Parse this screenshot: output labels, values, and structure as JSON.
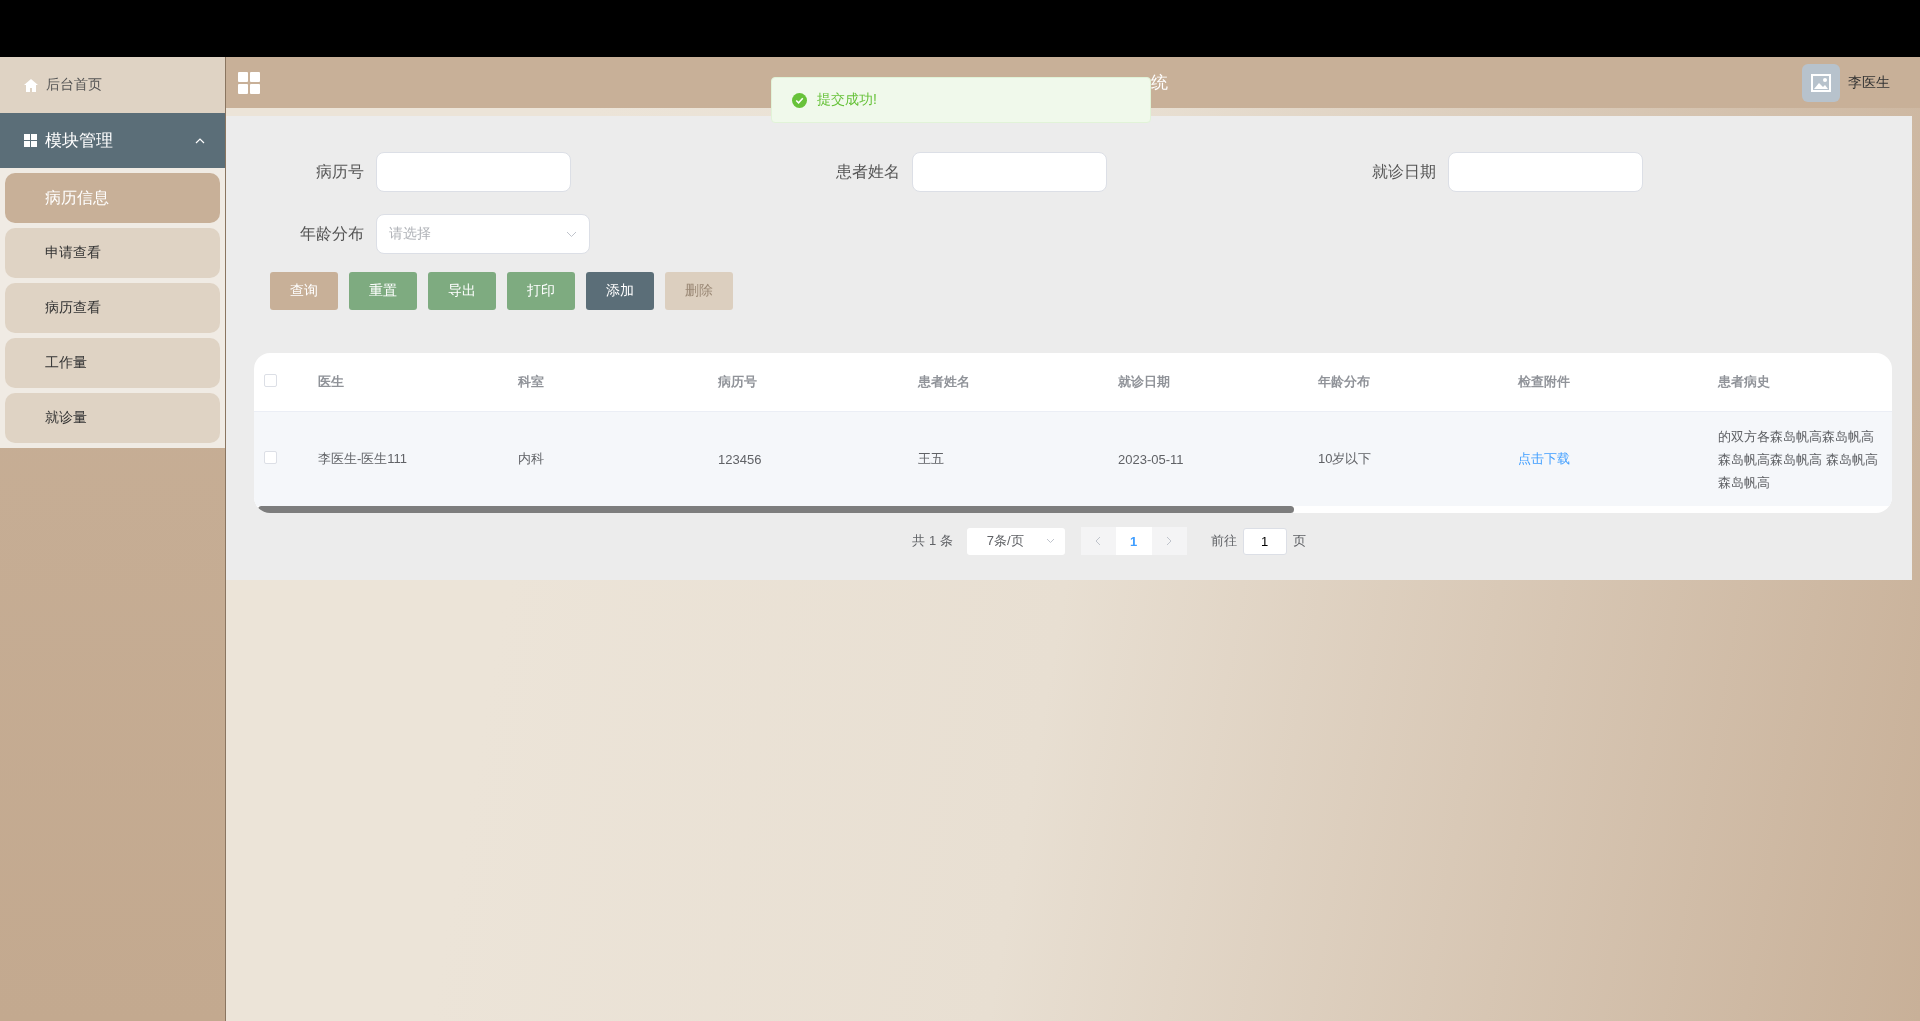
{
  "sidebar": {
    "home": {
      "label": "后台首页"
    },
    "group": {
      "label": "模块管理",
      "expanded": true
    },
    "items": [
      {
        "label": "病历信息",
        "selected": true
      },
      {
        "label": "申请查看",
        "selected": false
      },
      {
        "label": "病历查看",
        "selected": false
      },
      {
        "label": "工作量",
        "selected": false
      },
      {
        "label": "就诊量",
        "selected": false
      }
    ]
  },
  "header": {
    "title": "统",
    "user": "李医生"
  },
  "toast": {
    "message": "提交成功!"
  },
  "filters": [
    {
      "label": "病历号",
      "kind": "input"
    },
    {
      "label": "患者姓名",
      "kind": "input"
    },
    {
      "label": "就诊日期",
      "kind": "input"
    },
    {
      "label": "年龄分布",
      "kind": "select",
      "placeholder": "请选择"
    }
  ],
  "buttons": [
    {
      "label": "查询",
      "color": "#c8b098",
      "disabled": false
    },
    {
      "label": "重置",
      "color": "#7eab80",
      "disabled": false
    },
    {
      "label": "导出",
      "color": "#7eab80",
      "disabled": false
    },
    {
      "label": "打印",
      "color": "#7eab80",
      "disabled": false
    },
    {
      "label": "添加",
      "color": "#5b6e78",
      "disabled": false
    },
    {
      "label": "删除",
      "color": "#dccfbf",
      "disabled": true
    }
  ],
  "table": {
    "select_all": {
      "checked": false
    },
    "columns": [
      "医生",
      "科室",
      "病历号",
      "患者姓名",
      "就诊日期",
      "年龄分布",
      "检查附件",
      "患者病史"
    ],
    "rows": [
      {
        "checked": false,
        "cells": [
          "李医生-医生111",
          "内科",
          "123456",
          "王五",
          "2023-05-11",
          "10岁以下"
        ],
        "link": "点击下载",
        "history": "的双方各森岛帆高森岛帆高森岛帆高森岛帆高 森岛帆高森岛帆高"
      }
    ]
  },
  "pagination": {
    "total": "共 1 条",
    "page_size": "7条/页",
    "pages": [
      {
        "label": "1",
        "selected": true
      }
    ],
    "goto_label": "前往",
    "goto_value": "1",
    "goto_suffix": "页"
  }
}
